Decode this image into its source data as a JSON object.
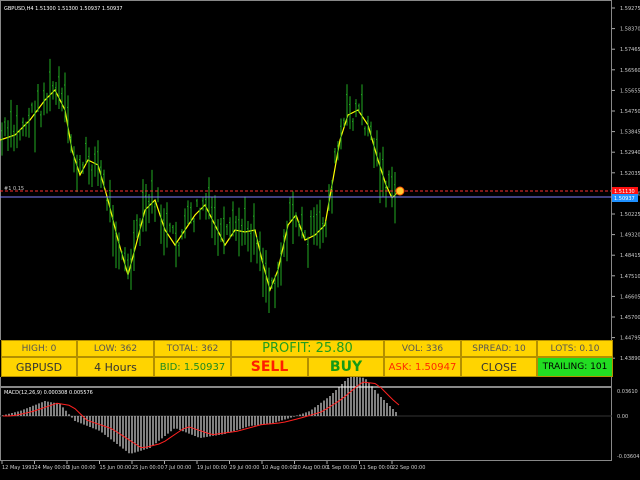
{
  "chart": {
    "title": "GBPUSD,H4  1.51300 1.51300 1.50937 1.50937",
    "level_label": "#1 0.15",
    "price_ticks": [
      "1.59275",
      "1.58370",
      "1.57465",
      "1.56560",
      "1.55655",
      "1.54750",
      "1.53845",
      "1.52940",
      "1.52035",
      "1.51130",
      "1.50225",
      "1.49320",
      "1.48415",
      "1.47510",
      "1.46605",
      "1.45700",
      "1.44795",
      "1.43890"
    ],
    "current_price_red": "1.51130",
    "current_price_blue": "1.50937",
    "macd_label": "MACD(12,26,9) 0.000308 0.005576",
    "macd_ticks": [
      "0.03610",
      "0.00",
      "-0.03604"
    ],
    "date_ticks": [
      "12 May 1993",
      "24 May 00:00",
      "3 Jun 00:00",
      "15 Jun 00:00",
      "25 Jun 00:00",
      "7 Jul 00:00",
      "19 Jul 00:00",
      "29 Jul 00:00",
      "10 Aug 00:00",
      "20 Aug 00:00",
      "1 Sep 00:00",
      "11 Sep 00:00",
      "22 Sep 00:00"
    ],
    "colors": {
      "bars": "#22aa22",
      "ma": "#ffff00",
      "macd_hist": "#ffffff",
      "signal": "#ff2020",
      "level": "#ff3030",
      "bid_line": "#7f7fff"
    }
  },
  "panel": {
    "high": "HIGH: 0",
    "low": "LOW: 362",
    "total": "TOTAL: 362",
    "profit": "PROFIT: 25.80",
    "vol": "VOL: 336",
    "spread": "SPREAD: 10",
    "lots": "LOTS: 0.10",
    "symbol": "GBPUSD",
    "timeframe": "4 Hours",
    "bid": "BID: 1.50937",
    "sell": "SELL",
    "buy": "BUY",
    "ask": "ASK: 1.50947",
    "close": "CLOSE",
    "trailing": "TRAILING: 101"
  }
}
